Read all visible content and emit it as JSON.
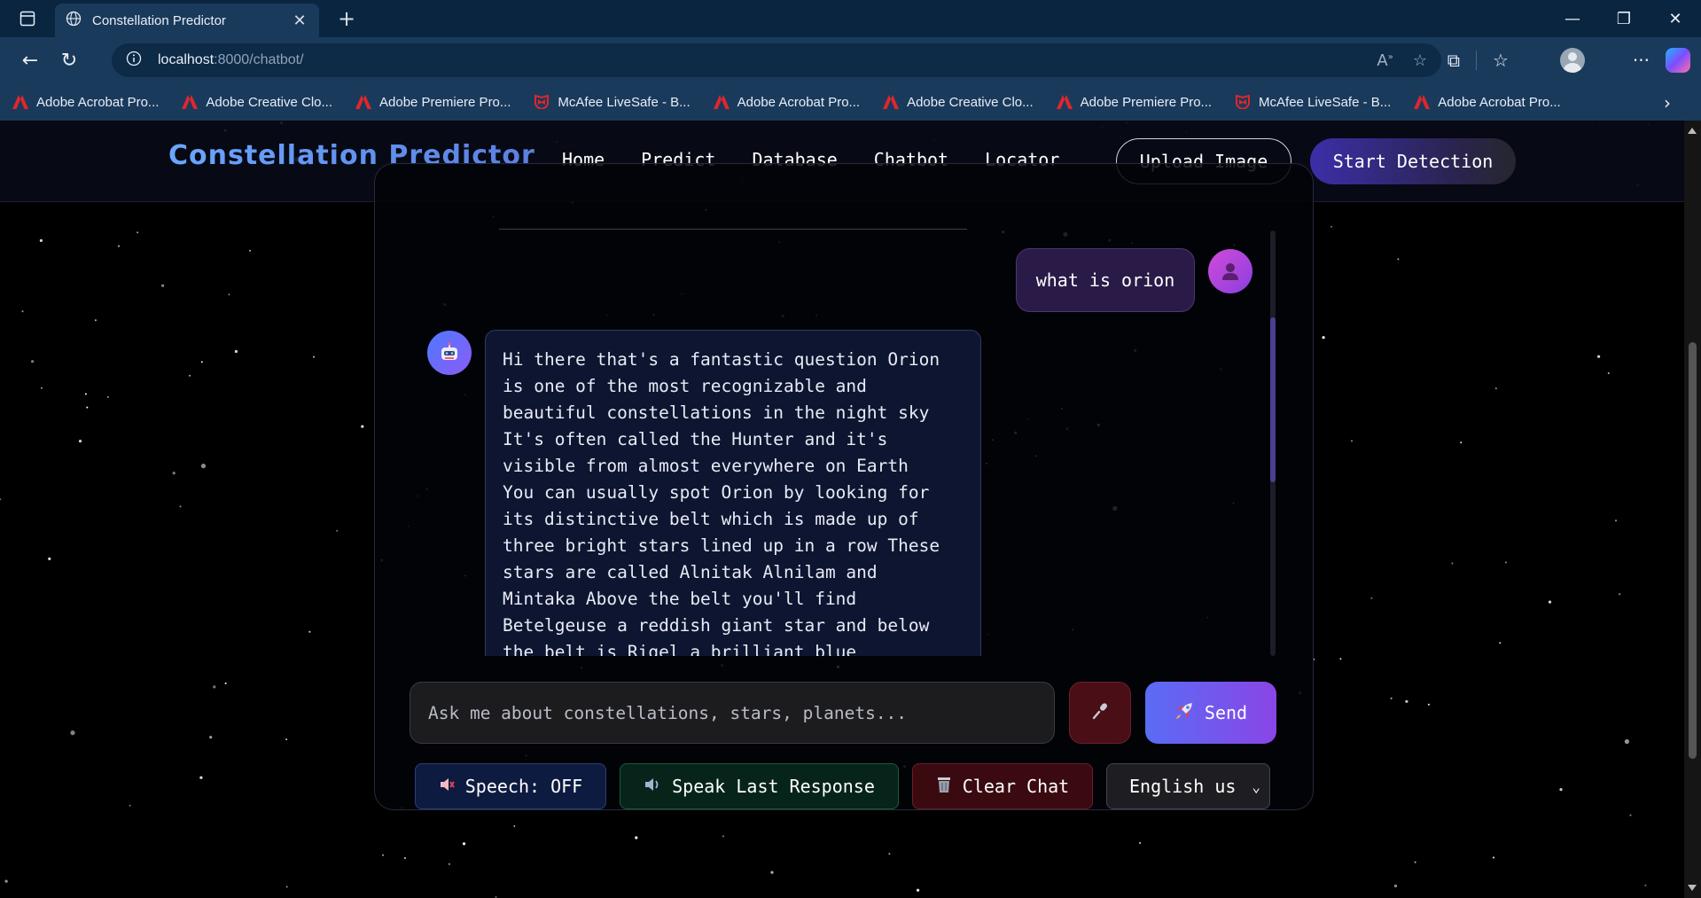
{
  "browser": {
    "tab_title": "Constellation Predictor",
    "url_host": "localhost",
    "url_path": ":8000/chatbot/",
    "bookmarks": [
      {
        "label": "Adobe Acrobat Pro...",
        "type": "adobe"
      },
      {
        "label": "Adobe Creative Clo...",
        "type": "adobe"
      },
      {
        "label": "Adobe Premiere Pro...",
        "type": "adobe"
      },
      {
        "label": "McAfee LiveSafe - B...",
        "type": "mcafee"
      },
      {
        "label": "Adobe Acrobat Pro...",
        "type": "adobe"
      },
      {
        "label": "Adobe Creative Clo...",
        "type": "adobe"
      },
      {
        "label": "Adobe Premiere Pro...",
        "type": "adobe"
      },
      {
        "label": "McAfee LiveSafe - B...",
        "type": "mcafee"
      },
      {
        "label": "Adobe Acrobat Pro...",
        "type": "adobe"
      }
    ]
  },
  "navbar": {
    "brand": "Constellation Predictor",
    "links": [
      "Home",
      "Predict",
      "Database",
      "Chatbot",
      "Locator"
    ],
    "upload_label": "Upload Image",
    "detect_label": "Start Detection"
  },
  "chat": {
    "user_message": "what is orion",
    "bot_lines": [
      "Hi there that's a fantastic question Orion",
      "is one of the most recognizable and",
      "beautiful constellations in the night sky",
      "It's often called the Hunter and it's",
      "visible from almost everywhere on Earth",
      "You can usually spot Orion by looking for",
      "its distinctive belt which is made up of",
      "three bright stars lined up in a row These",
      "stars are called Alnitak Alnilam and",
      "Mintaka Above the belt you'll find",
      "Betelgeuse a reddish giant star and below",
      "the belt is Rigel a brilliant blue"
    ],
    "input_placeholder": "Ask me about constellations, stars, planets...",
    "send_label": "Send",
    "speech_label": "Speech: OFF",
    "speak_label": "Speak Last Response",
    "clear_label": "Clear Chat",
    "language": "English us"
  },
  "colors": {
    "brand": "#5b8fe8",
    "send_gradient_start": "#5a6cf5",
    "send_gradient_end": "#8a45e6",
    "user_bubble": "#2a1a47",
    "bot_bubble": "#0d1530"
  }
}
